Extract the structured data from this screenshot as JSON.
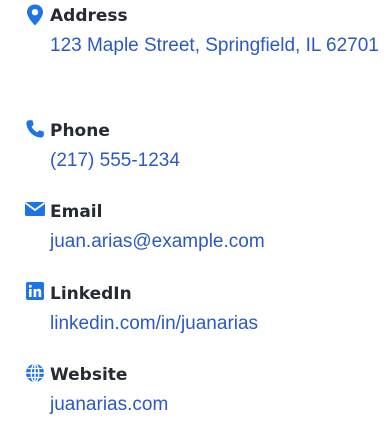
{
  "accent_color": "#1e73e8",
  "text_color": "#252a33",
  "value_color": "#2b59c3",
  "contacts": [
    {
      "icon": "map-pin-icon",
      "label": "Address",
      "value": "123 Maple Street, Springfield, IL 62701"
    },
    {
      "icon": "phone-icon",
      "label": "Phone",
      "value": "(217) 555-1234"
    },
    {
      "icon": "envelope-icon",
      "label": "Email",
      "value": "juan.arias@example.com"
    },
    {
      "icon": "linkedin-icon",
      "label": "LinkedIn",
      "value": "linkedin.com/in/juanarias"
    },
    {
      "icon": "globe-icon",
      "label": "Website",
      "value": "juanarias.com"
    }
  ]
}
